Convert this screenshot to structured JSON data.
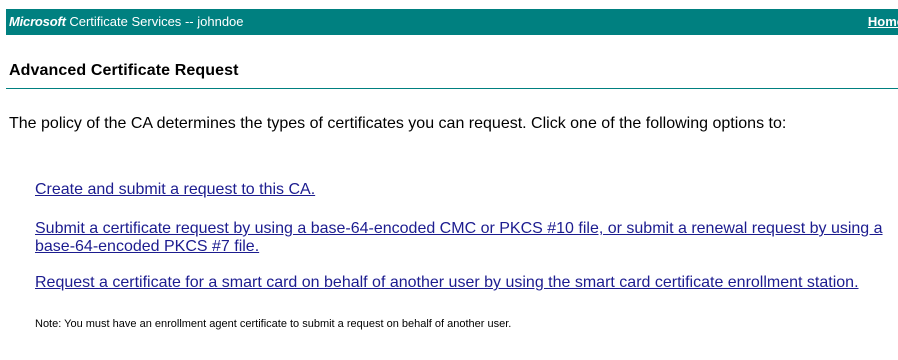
{
  "header": {
    "brand": "Microsoft",
    "service": "Certificate Services",
    "separator": "--",
    "user": "johndoe",
    "home_link": "Home"
  },
  "page": {
    "title": "Advanced Certificate Request",
    "intro": "The policy of the CA determines the types of certificates you can request. Click one of the following options to:"
  },
  "options": [
    {
      "label": "Create and submit a request to this CA."
    },
    {
      "label": "Submit a certificate request by using a base-64-encoded CMC or PKCS #10 file, or submit a renewal request by using a base-64-encoded PKCS #7 file."
    },
    {
      "label": "Request a certificate for a smart card on behalf of another user by using the smart card certificate enrollment station."
    }
  ],
  "note": "Note: You must have an enrollment agent certificate to submit a request on behalf of another user.",
  "colors": {
    "header_bg": "#008080",
    "link": "#1c1c8f"
  }
}
